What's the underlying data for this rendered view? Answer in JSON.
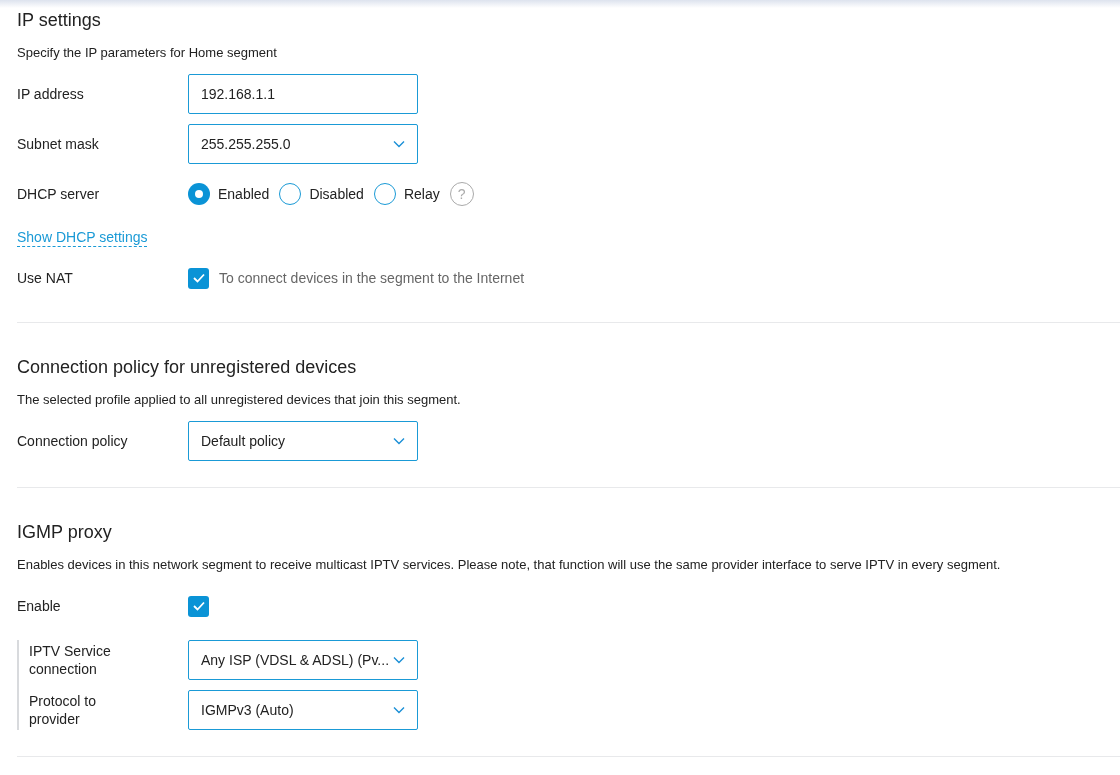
{
  "sections": [
    {
      "title": "IP settings",
      "description": "Specify the IP parameters for Home segment",
      "rows": [
        {
          "kind": "input",
          "label": "IP address",
          "value": "192.168.1.1"
        },
        {
          "kind": "select",
          "label": "Subnet mask",
          "value": "255.255.255.0"
        },
        {
          "kind": "radio",
          "label": "DHCP server",
          "options": [
            {
              "label": "Enabled",
              "selected": true
            },
            {
              "label": "Disabled",
              "selected": false
            },
            {
              "label": "Relay",
              "selected": false
            }
          ],
          "help": "?"
        },
        {
          "kind": "link",
          "text": "Show DHCP settings"
        },
        {
          "kind": "checkbox",
          "label": "Use NAT",
          "checked": true,
          "hint": "To connect devices in the segment to the Internet"
        }
      ]
    },
    {
      "title": "Connection policy for unregistered devices",
      "description": "The selected profile applied to all unregistered devices that join this segment.",
      "rows": [
        {
          "kind": "select",
          "label": "Connection policy",
          "value": "Default policy"
        }
      ]
    },
    {
      "title": "IGMP proxy",
      "description": "Enables devices in this network segment to receive multicast IPTV services. Please note, that function will use the same provider interface to serve IPTV in every segment.",
      "rows": [
        {
          "kind": "checkbox",
          "label": "Enable",
          "checked": true
        },
        {
          "kind": "group",
          "children": [
            {
              "kind": "select",
              "label": "IPTV Service connection",
              "value": "Any ISP (VDSL & ADSL) (Pv..."
            },
            {
              "kind": "select",
              "label": "Protocol to provider",
              "value": "IGMPv3 (Auto)"
            }
          ]
        }
      ]
    }
  ]
}
